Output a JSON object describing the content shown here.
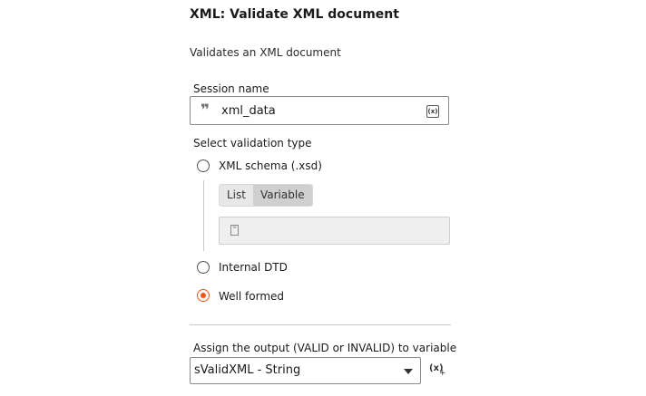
{
  "header": {
    "title": "XML: Validate XML document",
    "description": "Validates an XML document"
  },
  "session": {
    "label": "Session name",
    "value": "xml_data",
    "variable_icon": "(x)"
  },
  "validation": {
    "label": "Select validation type",
    "options": [
      {
        "label": "XML schema (.xsd)",
        "selected": false
      },
      {
        "label": "Internal DTD",
        "selected": false
      },
      {
        "label": "Well formed",
        "selected": true
      }
    ],
    "schema_source_toggle": {
      "options": [
        "List",
        "Variable"
      ],
      "active": "Variable"
    }
  },
  "output": {
    "label": "Assign the output (VALID or INVALID) to variable",
    "selected_value": "sValidXML - String",
    "add_variable_icon": "(x)",
    "add_variable_plus": "+"
  },
  "colors": {
    "accent": "#e8561a",
    "border": "#8a8a8a",
    "disabled_field": "#efefef"
  }
}
